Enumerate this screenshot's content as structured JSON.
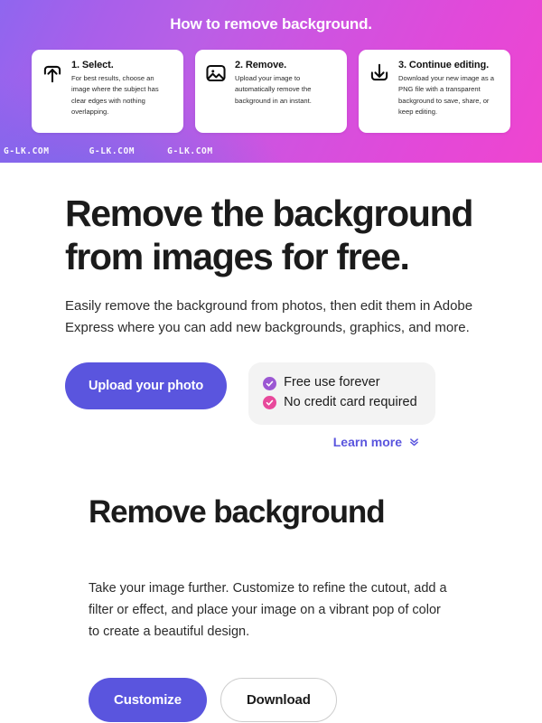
{
  "hero": {
    "title": "How to remove background.",
    "gradient_from": "#8f66ef",
    "gradient_to": "#ef45cf",
    "cards": [
      {
        "icon": "upload-icon",
        "title": "1. Select.",
        "desc": "For best results, choose an image where the subject has clear edges with nothing overlapping."
      },
      {
        "icon": "image-icon",
        "title": "2. Remove.",
        "desc": "Upload your image to automatically remove the background in an instant."
      },
      {
        "icon": "download-icon",
        "title": "3. Continue editing.",
        "desc": "Download your new image as a PNG file with a transparent background to save, share, or keep editing."
      }
    ],
    "watermarks": [
      "G-LK.COM",
      "G-LK.COM",
      "G-LK.COM"
    ]
  },
  "main": {
    "headline": "Remove the background from images for free.",
    "subtext": "Easily remove the background from photos, then edit them in Adobe Express where you can add new backgrounds, graphics, and more.",
    "upload_button": "Upload your photo",
    "upload_button_color": "#5a55de",
    "benefits": [
      {
        "label": "Free use forever",
        "check_color": "#9b57d3"
      },
      {
        "label": "No credit card required",
        "check_color": "#e8499b"
      }
    ],
    "learn_more": "Learn more",
    "learn_more_color": "#5a55de"
  },
  "section2": {
    "heading": "Remove background",
    "paragraph": "Take your image further. Customize to refine the cutout, add a filter or effect, and place your image on a vibrant pop of color to create a beautiful design.",
    "customize_button": "Customize",
    "download_button": "Download"
  }
}
